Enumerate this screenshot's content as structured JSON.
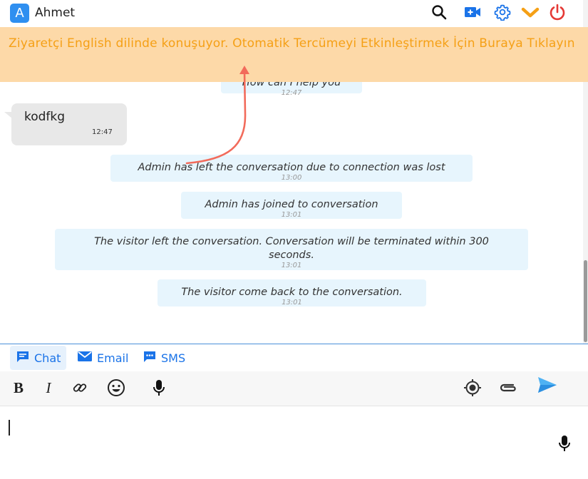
{
  "header": {
    "avatar_letter": "A",
    "agent_name": "Ahmet",
    "icons": [
      "search-icon",
      "video-add-icon",
      "gear-icon",
      "chevron-down-icon",
      "power-icon"
    ],
    "colors": {
      "accent": "#1a73e8",
      "chevron": "#f5a016",
      "power": "#e53935"
    }
  },
  "banner": {
    "text": "Ziyaretçi English dilinde konuşuyor. Otomatik Tercümeyi Etkinleştirmek İçin Buraya Tıklayın",
    "bg": "#fdd9a8",
    "color": "#f5a016"
  },
  "messages": {
    "partial": {
      "text": "How can I help you",
      "time": "12:47"
    },
    "visitor": {
      "text": "kodfkg",
      "time": "12:47"
    },
    "system": [
      {
        "text": "Admin has left the conversation due to connection was lost",
        "time": "13:00"
      },
      {
        "text": "Admin has joined to conversation",
        "time": "13:01"
      },
      {
        "text": "The visitor left the conversation. Conversation will be terminated within 300 seconds.",
        "time": "13:01"
      },
      {
        "text": "The visitor come back to the conversation.",
        "time": "13:01"
      }
    ]
  },
  "tabs": [
    {
      "label": "Chat",
      "active": true
    },
    {
      "label": "Email",
      "active": false
    },
    {
      "label": "SMS",
      "active": false
    }
  ],
  "toolbar": {
    "bold": "B",
    "italic": "I",
    "tools": [
      "link-icon",
      "emoji-icon",
      "microphone-icon",
      "location-icon",
      "attachment-icon",
      "send-icon"
    ]
  },
  "composer": {
    "value": "",
    "placeholder": ""
  }
}
